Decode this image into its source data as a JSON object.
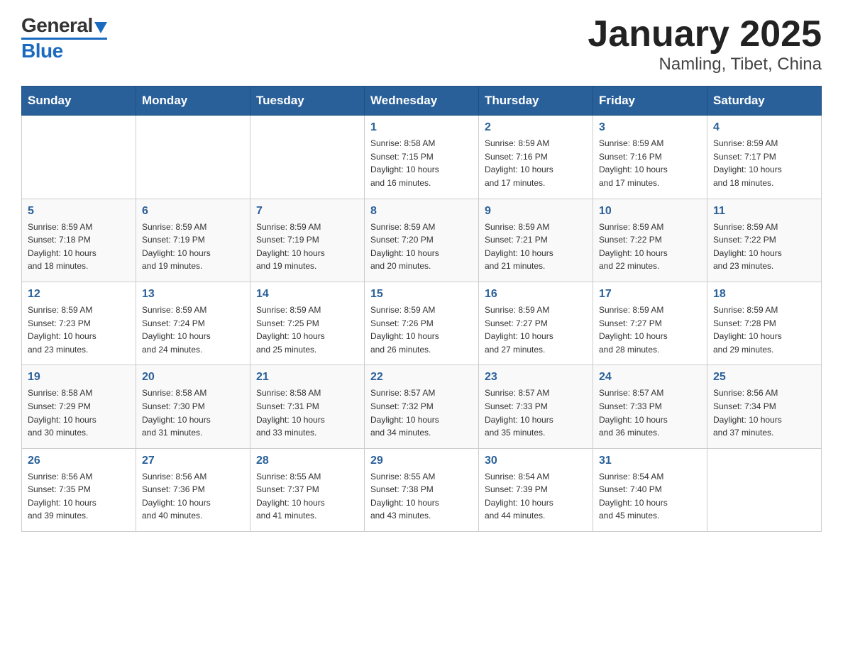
{
  "logo": {
    "text_general": "General",
    "text_blue": "Blue"
  },
  "title": "January 2025",
  "subtitle": "Namling, Tibet, China",
  "days_of_week": [
    "Sunday",
    "Monday",
    "Tuesday",
    "Wednesday",
    "Thursday",
    "Friday",
    "Saturday"
  ],
  "weeks": [
    [
      {
        "day": "",
        "info": ""
      },
      {
        "day": "",
        "info": ""
      },
      {
        "day": "",
        "info": ""
      },
      {
        "day": "1",
        "info": "Sunrise: 8:58 AM\nSunset: 7:15 PM\nDaylight: 10 hours\nand 16 minutes."
      },
      {
        "day": "2",
        "info": "Sunrise: 8:59 AM\nSunset: 7:16 PM\nDaylight: 10 hours\nand 17 minutes."
      },
      {
        "day": "3",
        "info": "Sunrise: 8:59 AM\nSunset: 7:16 PM\nDaylight: 10 hours\nand 17 minutes."
      },
      {
        "day": "4",
        "info": "Sunrise: 8:59 AM\nSunset: 7:17 PM\nDaylight: 10 hours\nand 18 minutes."
      }
    ],
    [
      {
        "day": "5",
        "info": "Sunrise: 8:59 AM\nSunset: 7:18 PM\nDaylight: 10 hours\nand 18 minutes."
      },
      {
        "day": "6",
        "info": "Sunrise: 8:59 AM\nSunset: 7:19 PM\nDaylight: 10 hours\nand 19 minutes."
      },
      {
        "day": "7",
        "info": "Sunrise: 8:59 AM\nSunset: 7:19 PM\nDaylight: 10 hours\nand 19 minutes."
      },
      {
        "day": "8",
        "info": "Sunrise: 8:59 AM\nSunset: 7:20 PM\nDaylight: 10 hours\nand 20 minutes."
      },
      {
        "day": "9",
        "info": "Sunrise: 8:59 AM\nSunset: 7:21 PM\nDaylight: 10 hours\nand 21 minutes."
      },
      {
        "day": "10",
        "info": "Sunrise: 8:59 AM\nSunset: 7:22 PM\nDaylight: 10 hours\nand 22 minutes."
      },
      {
        "day": "11",
        "info": "Sunrise: 8:59 AM\nSunset: 7:22 PM\nDaylight: 10 hours\nand 23 minutes."
      }
    ],
    [
      {
        "day": "12",
        "info": "Sunrise: 8:59 AM\nSunset: 7:23 PM\nDaylight: 10 hours\nand 23 minutes."
      },
      {
        "day": "13",
        "info": "Sunrise: 8:59 AM\nSunset: 7:24 PM\nDaylight: 10 hours\nand 24 minutes."
      },
      {
        "day": "14",
        "info": "Sunrise: 8:59 AM\nSunset: 7:25 PM\nDaylight: 10 hours\nand 25 minutes."
      },
      {
        "day": "15",
        "info": "Sunrise: 8:59 AM\nSunset: 7:26 PM\nDaylight: 10 hours\nand 26 minutes."
      },
      {
        "day": "16",
        "info": "Sunrise: 8:59 AM\nSunset: 7:27 PM\nDaylight: 10 hours\nand 27 minutes."
      },
      {
        "day": "17",
        "info": "Sunrise: 8:59 AM\nSunset: 7:27 PM\nDaylight: 10 hours\nand 28 minutes."
      },
      {
        "day": "18",
        "info": "Sunrise: 8:59 AM\nSunset: 7:28 PM\nDaylight: 10 hours\nand 29 minutes."
      }
    ],
    [
      {
        "day": "19",
        "info": "Sunrise: 8:58 AM\nSunset: 7:29 PM\nDaylight: 10 hours\nand 30 minutes."
      },
      {
        "day": "20",
        "info": "Sunrise: 8:58 AM\nSunset: 7:30 PM\nDaylight: 10 hours\nand 31 minutes."
      },
      {
        "day": "21",
        "info": "Sunrise: 8:58 AM\nSunset: 7:31 PM\nDaylight: 10 hours\nand 33 minutes."
      },
      {
        "day": "22",
        "info": "Sunrise: 8:57 AM\nSunset: 7:32 PM\nDaylight: 10 hours\nand 34 minutes."
      },
      {
        "day": "23",
        "info": "Sunrise: 8:57 AM\nSunset: 7:33 PM\nDaylight: 10 hours\nand 35 minutes."
      },
      {
        "day": "24",
        "info": "Sunrise: 8:57 AM\nSunset: 7:33 PM\nDaylight: 10 hours\nand 36 minutes."
      },
      {
        "day": "25",
        "info": "Sunrise: 8:56 AM\nSunset: 7:34 PM\nDaylight: 10 hours\nand 37 minutes."
      }
    ],
    [
      {
        "day": "26",
        "info": "Sunrise: 8:56 AM\nSunset: 7:35 PM\nDaylight: 10 hours\nand 39 minutes."
      },
      {
        "day": "27",
        "info": "Sunrise: 8:56 AM\nSunset: 7:36 PM\nDaylight: 10 hours\nand 40 minutes."
      },
      {
        "day": "28",
        "info": "Sunrise: 8:55 AM\nSunset: 7:37 PM\nDaylight: 10 hours\nand 41 minutes."
      },
      {
        "day": "29",
        "info": "Sunrise: 8:55 AM\nSunset: 7:38 PM\nDaylight: 10 hours\nand 43 minutes."
      },
      {
        "day": "30",
        "info": "Sunrise: 8:54 AM\nSunset: 7:39 PM\nDaylight: 10 hours\nand 44 minutes."
      },
      {
        "day": "31",
        "info": "Sunrise: 8:54 AM\nSunset: 7:40 PM\nDaylight: 10 hours\nand 45 minutes."
      },
      {
        "day": "",
        "info": ""
      }
    ]
  ]
}
